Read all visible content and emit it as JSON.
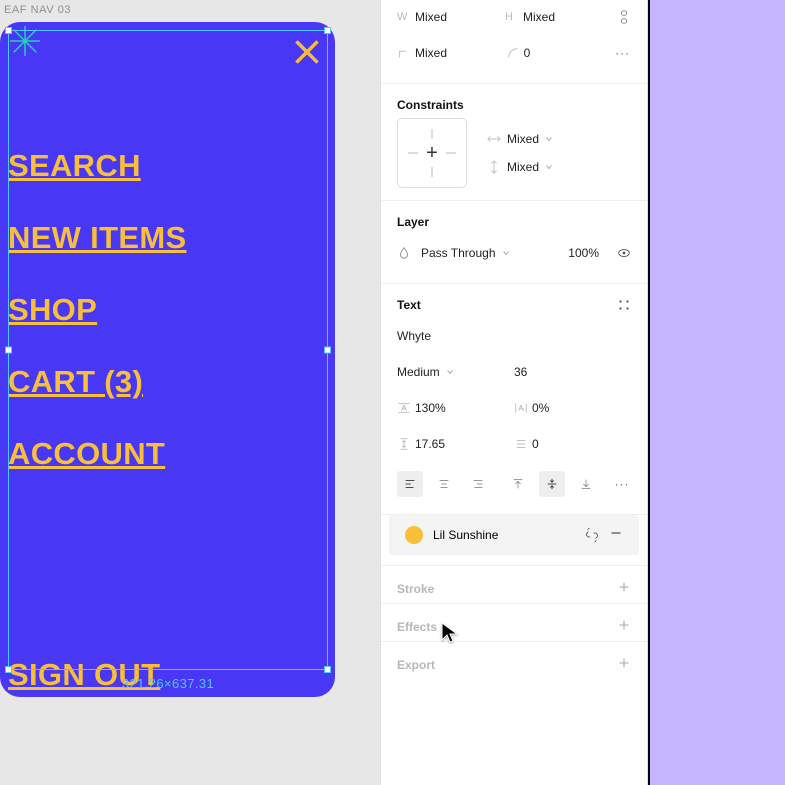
{
  "frame": {
    "label": "EAF NAV 03",
    "nav_items": [
      "SEARCH",
      "NEW ITEMS",
      "SHOP",
      "CART (3)",
      "ACCOUNT"
    ],
    "sign_out": "SIGN OUT",
    "selection_dims": "321.26×637.31"
  },
  "dims": {
    "w_lab": "W",
    "w_val": "Mixed",
    "h_lab": "H",
    "h_val": "Mixed",
    "rot_val": "Mixed",
    "corner_val": "0"
  },
  "constraints": {
    "title": "Constraints",
    "horiz": "Mixed",
    "vert": "Mixed"
  },
  "layer": {
    "title": "Layer",
    "blend": "Pass Through",
    "opacity": "100%"
  },
  "text": {
    "title": "Text",
    "font": "Whyte",
    "weight": "Medium",
    "size": "36",
    "lineheight": "130%",
    "letterspacing": "0%",
    "paragraph": "17.65",
    "list": "0"
  },
  "fill": {
    "color_name": "Lil Sunshine",
    "swatch_hex": "#f9be3a"
  },
  "stroke_title": "Stroke",
  "effects_title": "Effects",
  "export_title": "Export"
}
